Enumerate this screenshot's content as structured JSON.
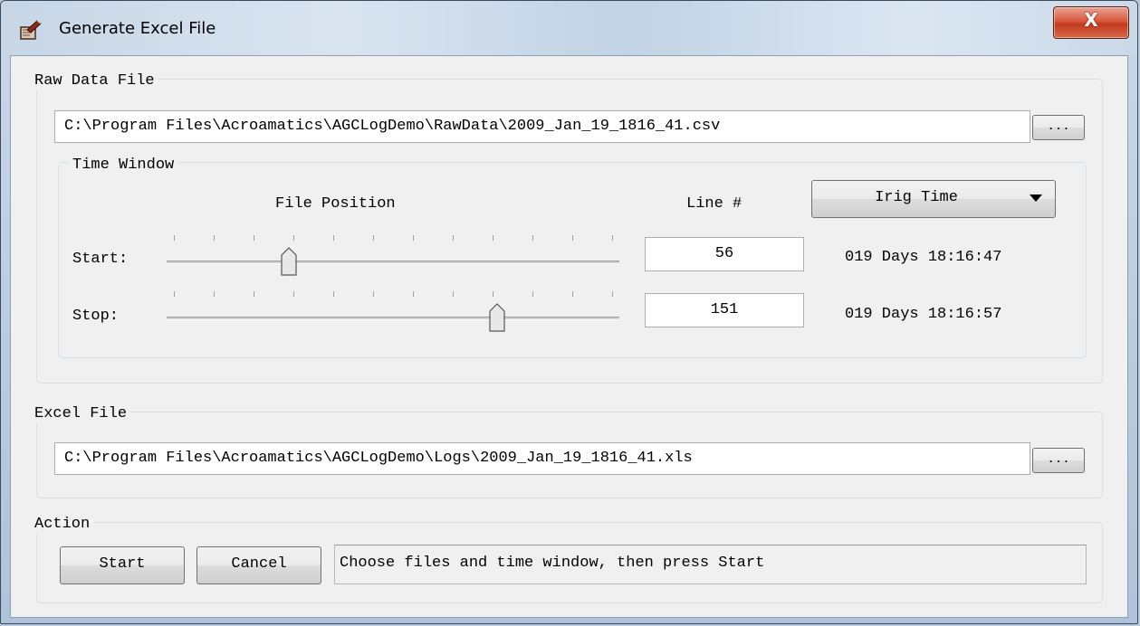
{
  "window": {
    "title": "Generate Excel File",
    "close_label": "X"
  },
  "raw_data": {
    "group_label": "Raw Data File",
    "path": "C:\\Program Files\\Acroamatics\\AGCLogDemo\\RawData\\2009_Jan_19_1816_41.csv",
    "browse_label": "..."
  },
  "time_window": {
    "group_label": "Time Window",
    "file_position_label": "File Position",
    "line_label": "Line #",
    "time_format": {
      "selected": "Irig Time"
    },
    "start": {
      "label": "Start:",
      "position": 0.27,
      "line": "56",
      "time": "019 Days 18:16:47"
    },
    "stop": {
      "label": "Stop:",
      "position": 0.73,
      "line": "151",
      "time": "019 Days 18:16:57"
    }
  },
  "excel": {
    "group_label": "Excel File",
    "path": "C:\\Program Files\\Acroamatics\\AGCLogDemo\\Logs\\2009_Jan_19_1816_41.xls",
    "browse_label": "..."
  },
  "action": {
    "group_label": "Action",
    "start_label": "Start",
    "cancel_label": "Cancel",
    "status_text": "Choose files and time window, then press Start"
  }
}
